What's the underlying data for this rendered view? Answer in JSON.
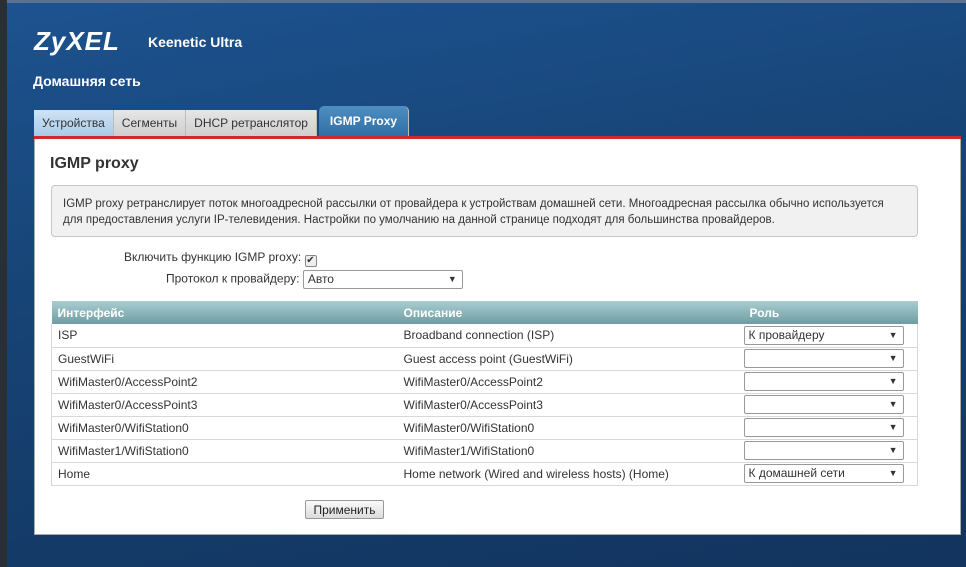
{
  "header": {
    "brand": "ZyXEL",
    "model": "Keenetic Ultra",
    "section": "Домашняя сеть"
  },
  "tabs": [
    "Устройства",
    "Сегменты",
    "DHCP ретранслятор",
    "IGMP Proxy"
  ],
  "panel": {
    "title": "IGMP proxy",
    "info": "IGMP proxy ретранслирует поток многоадресной рассылки от провайдера к устройствам домашней сети. Многоадресная рассылка обычно используется для предоставления услуги IP-телевидения. Настройки по умолчанию на данной странице подходят для большинства провайдеров.",
    "enable_label": "Включить функцию IGMP proxy:",
    "enable_checked": true,
    "protocol_label": "Протокол к провайдеру:",
    "protocol_value": "Авто",
    "columns": [
      "Интерфейс",
      "Описание",
      "Роль"
    ],
    "rows": [
      {
        "iface": "ISP",
        "desc": "Broadband connection (ISP)",
        "role": "К провайдеру"
      },
      {
        "iface": "GuestWiFi",
        "desc": "Guest access point (GuestWiFi)",
        "role": ""
      },
      {
        "iface": "WifiMaster0/AccessPoint2",
        "desc": "WifiMaster0/AccessPoint2",
        "role": ""
      },
      {
        "iface": "WifiMaster0/AccessPoint3",
        "desc": "WifiMaster0/AccessPoint3",
        "role": ""
      },
      {
        "iface": "WifiMaster0/WifiStation0",
        "desc": "WifiMaster0/WifiStation0",
        "role": ""
      },
      {
        "iface": "WifiMaster1/WifiStation0",
        "desc": "WifiMaster1/WifiStation0",
        "role": ""
      },
      {
        "iface": "Home",
        "desc": "Home network (Wired and wireless hosts) (Home)",
        "role": "К домашней сети"
      }
    ],
    "apply": "Применить"
  }
}
